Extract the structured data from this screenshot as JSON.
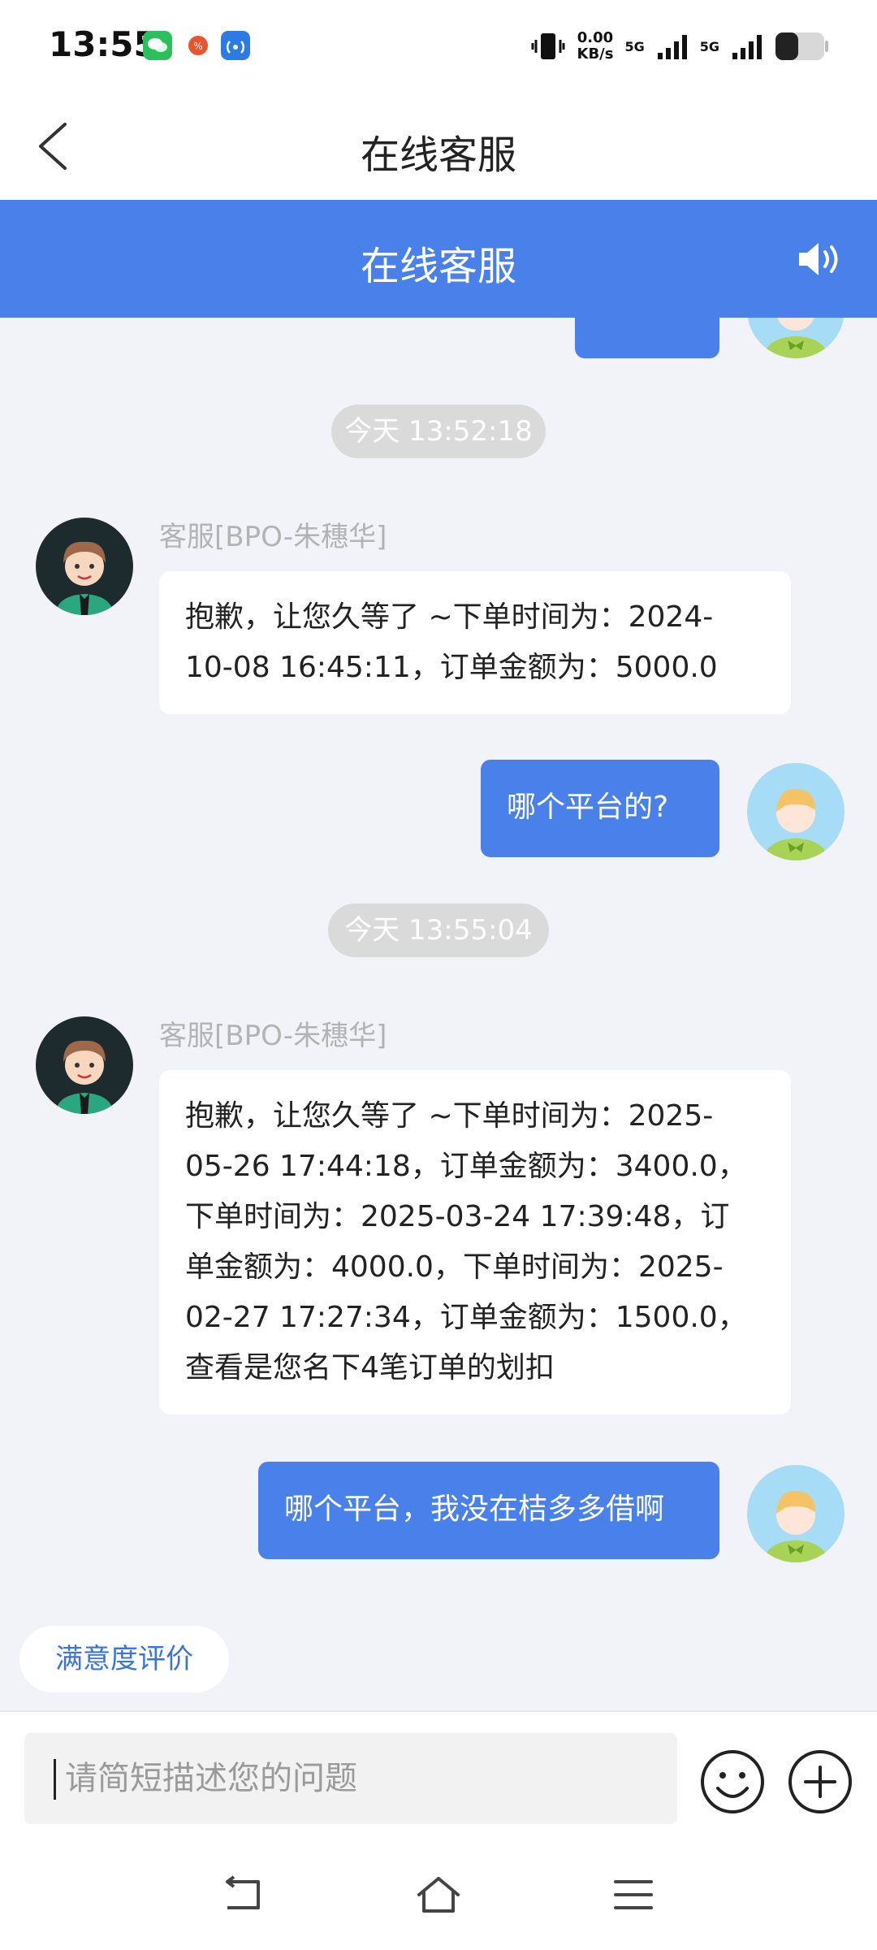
{
  "status_bar": {
    "time": "13:55",
    "net_speed_value": "0.00",
    "net_speed_unit": "KB/s",
    "sim1": "5G",
    "sim2": "5G"
  },
  "titlebar": {
    "title": "在线客服"
  },
  "header": {
    "title": "在线客服"
  },
  "chat": {
    "messages": [
      {
        "type": "timestamp",
        "text": "今天 13:52:18"
      },
      {
        "type": "agent",
        "name": "客服[BPO-朱穗华]",
        "lines": [
          "抱歉，让您久等了 ~下单时间为：2024-",
          "10-08 16:45:11，订单金额为：5000.0"
        ]
      },
      {
        "type": "user",
        "text": "哪个平台的?"
      },
      {
        "type": "timestamp",
        "text": "今天 13:55:04"
      },
      {
        "type": "agent",
        "name": "客服[BPO-朱穗华]",
        "lines": [
          "抱歉，让您久等了 ~下单时间为：2025-",
          "05-26 17:44:18，订单金额为：3400.0，",
          "下单时间为：2025-03-24 17:39:48，订",
          "单金额为：4000.0，下单时间为：2025-",
          "02-27 17:27:34，订单金额为：1500.0，",
          "查看是您名下4笔订单的划扣"
        ]
      },
      {
        "type": "user",
        "text": "哪个平台，我没在桔多多借啊"
      }
    ],
    "rating_button": "满意度评价"
  },
  "input": {
    "placeholder": "请简短描述您的问题"
  },
  "colors": {
    "accent": "#4a80ea",
    "background": "#f2f3f8",
    "link": "#3a74d9"
  }
}
